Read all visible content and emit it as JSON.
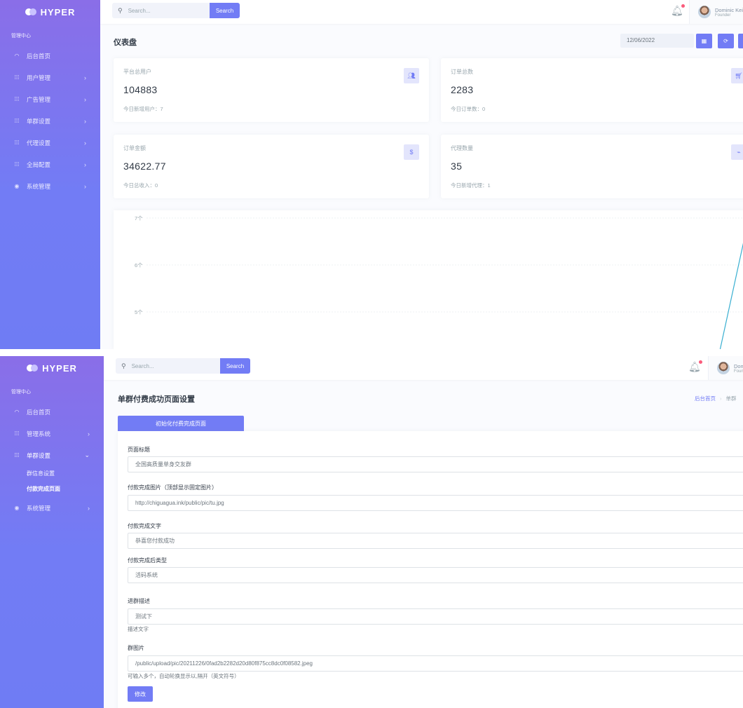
{
  "colors": {
    "primary": "#727cf5",
    "sidebar_top": "#8a6ee8",
    "text_dark": "#313a46",
    "muted": "#98a6ad",
    "chart_line": "#39afd1",
    "notify": "#fa5c7c"
  },
  "brand": {
    "name": "HYPER"
  },
  "user": {
    "name": "Dominic Kei",
    "role": "Founder"
  },
  "search": {
    "placeholder": "Search...",
    "button": "Search"
  },
  "dashboard": {
    "sidebar": {
      "section": "管理中心",
      "items": [
        {
          "label": "后台首页",
          "icon": "speedometer-icon"
        },
        {
          "label": "用户管理",
          "icon": "grid-icon"
        },
        {
          "label": "广告管理",
          "icon": "grid-icon"
        },
        {
          "label": "单群设置",
          "icon": "grid-icon"
        },
        {
          "label": "代理设置",
          "icon": "grid-icon"
        },
        {
          "label": "全局配置",
          "icon": "grid-icon"
        },
        {
          "label": "系统管理",
          "icon": "location-pin-icon"
        }
      ]
    },
    "title": "仪表盘",
    "date": "12/06/2022",
    "cards": [
      {
        "label": "平台总用户",
        "value": "104883",
        "footer": "今日新增用户：7",
        "icon": "users-icon"
      },
      {
        "label": "订单总数",
        "value": "2283",
        "footer": "今日订单数：0",
        "icon": "cart-icon"
      },
      {
        "label": "订单金额",
        "value": "34622.77",
        "footer": "今日总收入：0",
        "icon": "dollar-icon"
      },
      {
        "label": "代理数量",
        "value": "35",
        "footer": "今日新增代理：1",
        "icon": "pulse-icon"
      }
    ]
  },
  "chart_data": {
    "type": "line",
    "y_ticks": [
      "7个",
      "6个",
      "5个"
    ],
    "ylim": [
      5,
      7
    ],
    "series_color": "#39afd1",
    "grid": true
  },
  "settings": {
    "sidebar": {
      "section": "管理中心",
      "items": [
        {
          "label": "后台首页",
          "icon": "speedometer-icon"
        },
        {
          "label": "管理系统",
          "icon": "grid-icon"
        },
        {
          "label": "单群设置",
          "icon": "grid-icon"
        },
        {
          "label": "系统管理",
          "icon": "location-pin-icon"
        }
      ],
      "sub_items": [
        "群信息设置",
        "付款完成页面"
      ]
    },
    "title": "单群付费成功页面设置",
    "breadcrumb": {
      "home": "后台首页",
      "current": "单群"
    },
    "tab": "初始化付费完成页面",
    "fields": [
      {
        "label": "页面标题",
        "value": "全国高质量单身交友群"
      },
      {
        "label": "付款完成图片（顶部显示固定图片）",
        "value": "http://chiguagua.ink/public/pic/tu.jpg"
      },
      {
        "label": "付款完成文字",
        "value": "恭喜您付款成功"
      },
      {
        "label": "付款完成后类型",
        "value": "活码系统"
      },
      {
        "label": "进群描述",
        "value": "测试下",
        "help": "描述文字"
      },
      {
        "label": "群图片",
        "value": "/public/upload/pic/20211226/0fad2b2282d20d80f875cc8dc0f08582.jpeg",
        "help": "可输入多个，自动轮换显示以,隔开（英文符号）"
      }
    ],
    "submit": "修改"
  }
}
